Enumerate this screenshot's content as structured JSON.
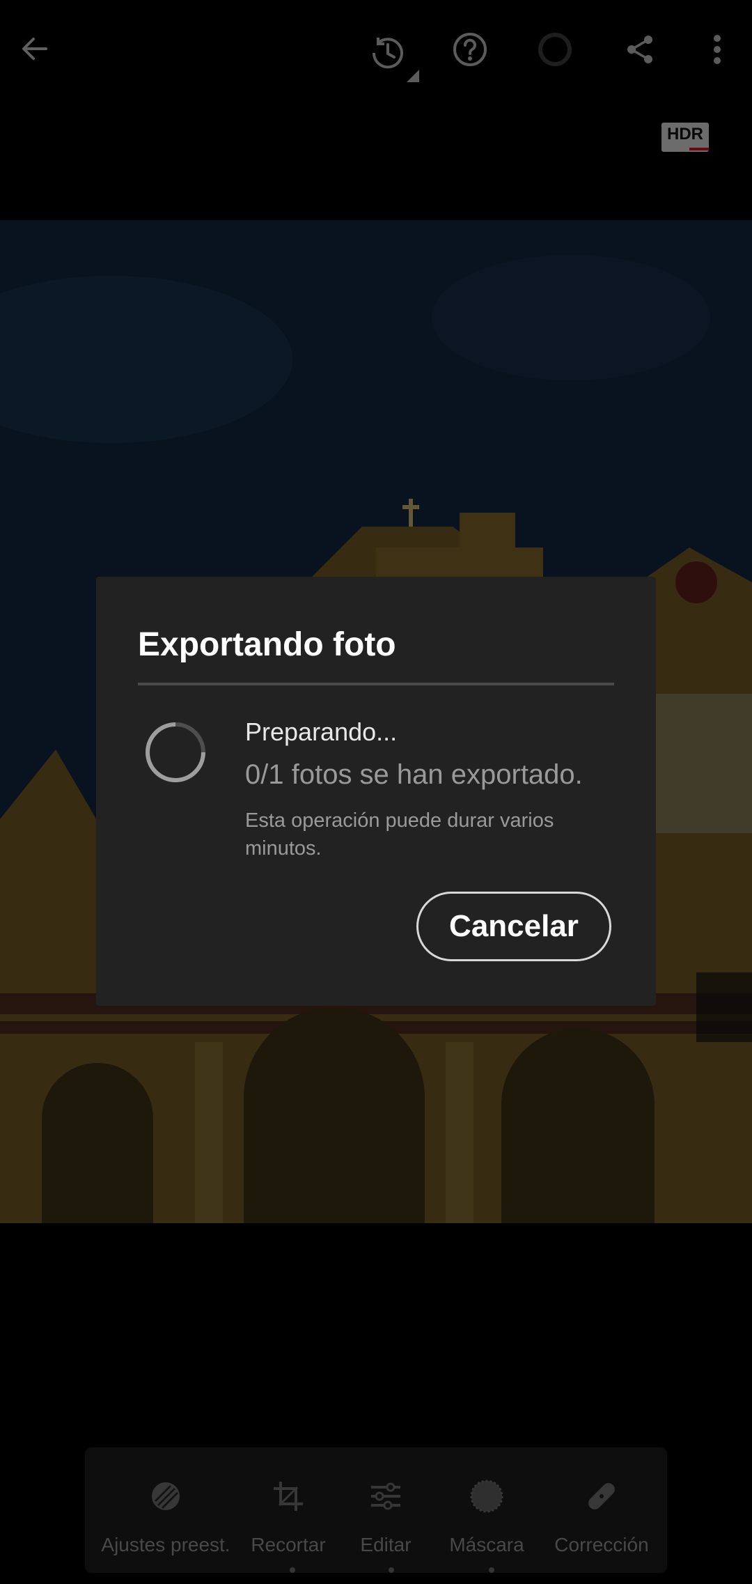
{
  "topbar": {
    "back_icon": "arrow-left-icon",
    "history_icon": "history-icon",
    "help_icon": "help-icon",
    "profile_icon": "circle-icon",
    "share_icon": "share-icon",
    "more_icon": "more-vertical-icon",
    "hdr_label": "HDR"
  },
  "dialog": {
    "title": "Exportando foto",
    "status": "Preparando...",
    "progress": "0/1 fotos se han exportado.",
    "note": "Esta operación puede durar varios minutos.",
    "cancel_label": "Cancelar"
  },
  "toolbar": {
    "items": [
      {
        "label": "Ajustes preest.",
        "icon": "presets-icon"
      },
      {
        "label": "Recortar",
        "icon": "crop-icon"
      },
      {
        "label": "Editar",
        "icon": "sliders-icon"
      },
      {
        "label": "Máscara",
        "icon": "mask-icon"
      },
      {
        "label": "Corrección",
        "icon": "healing-bandage-icon"
      }
    ]
  },
  "colors": {
    "background": "#000000",
    "dialog_bg": "#222222",
    "accent_red": "#c8141e"
  }
}
